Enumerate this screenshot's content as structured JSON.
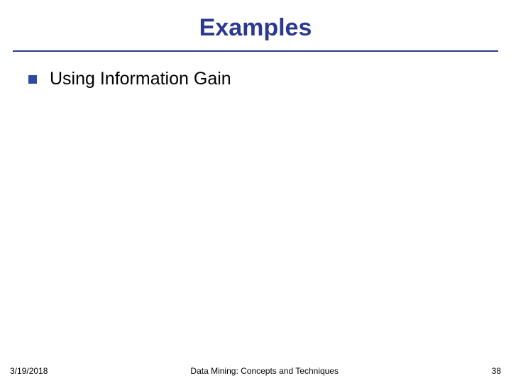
{
  "slide": {
    "title": "Examples",
    "bullets": [
      {
        "text": "Using Information Gain"
      }
    ]
  },
  "footer": {
    "date": "3/19/2018",
    "center": "Data Mining: Concepts and Techniques",
    "page": "38"
  },
  "colors": {
    "title": "#2b3a8f",
    "rule": "#2b3a8f",
    "bullet_square": "#2d4aa3"
  }
}
